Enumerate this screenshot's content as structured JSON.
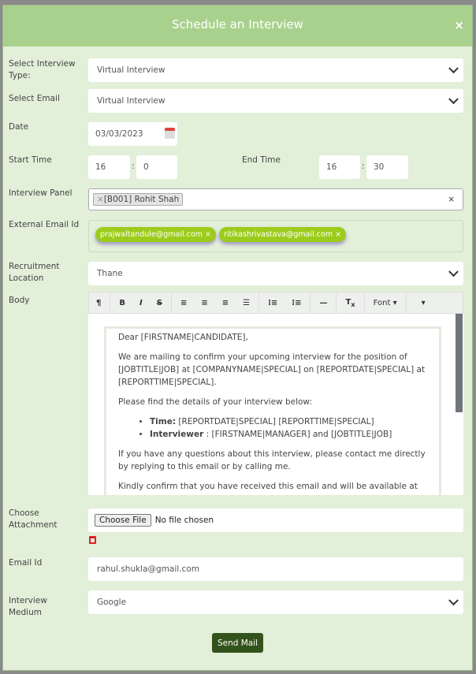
{
  "modal": {
    "title": "Schedule an Interview",
    "close": "×"
  },
  "fields": {
    "interview_type": {
      "label": "Select Interview Type:",
      "value": "Virtual Interview"
    },
    "email_template": {
      "label": "Select Email",
      "value": "Virtual Interview"
    },
    "date": {
      "label": "Date",
      "value": "03/03/2023"
    },
    "start_time": {
      "label": "Start Time",
      "hour": "16",
      "minute": "0"
    },
    "end_time": {
      "label": "End Time",
      "hour": "16",
      "minute": "30"
    },
    "time_sep": ":",
    "panel": {
      "label": "Interview Panel",
      "tags": [
        "[B001] Rohit Shah"
      ],
      "tag_remove": "×",
      "clear": "×"
    },
    "external_email": {
      "label": "External Email Id",
      "chips": [
        "prajwaltandule@gmail.com",
        "ritikashrivastava@gmail.com"
      ],
      "chip_remove": "×"
    },
    "location": {
      "label": "Recruitment Location",
      "value": "Thane"
    },
    "body": {
      "label": "Body"
    },
    "attachment": {
      "label": "Choose Attachment",
      "button": "Choose File",
      "status": "No file chosen"
    },
    "email_id": {
      "label": "Email Id",
      "value": "rahul.shukla@gmail.com"
    },
    "medium": {
      "label": "Interview Medium",
      "value": "Google"
    }
  },
  "toolbar": {
    "paragraph": "¶",
    "bold": "B",
    "italic": "I",
    "strike": "S",
    "font": "Font ▾"
  },
  "body_content": {
    "greeting": "Dear [FIRSTNAME|CANDIDATE],",
    "p1": "We are mailing to confirm your upcoming interview for the position of [JOBTITLE|JOB] at [COMPANYNAME|SPECIAL] on [REPORTDATE|SPECIAL] at [REPORTTIME|SPECIAL].",
    "p2": "Please find the details of your interview below:",
    "items": [
      {
        "label": "Time:",
        "text": " [REPORTDATE|SPECIAL] [REPORTTIME|SPECIAL]"
      },
      {
        "label": "Interviewer",
        "text": " : [FIRSTNAME|MANAGER] and [JOBTITLE|JOB]"
      }
    ],
    "p3": "If you have any questions about this interview, please contact me directly by replying to this email or by calling me.",
    "p4": "Kindly confirm that you have received this email and will be available at the"
  },
  "submit": "Send Mail",
  "colors": {
    "header": "#a9d18e",
    "background": "#e2efd9",
    "chip": "#9ccc1b",
    "button": "#33531c"
  }
}
